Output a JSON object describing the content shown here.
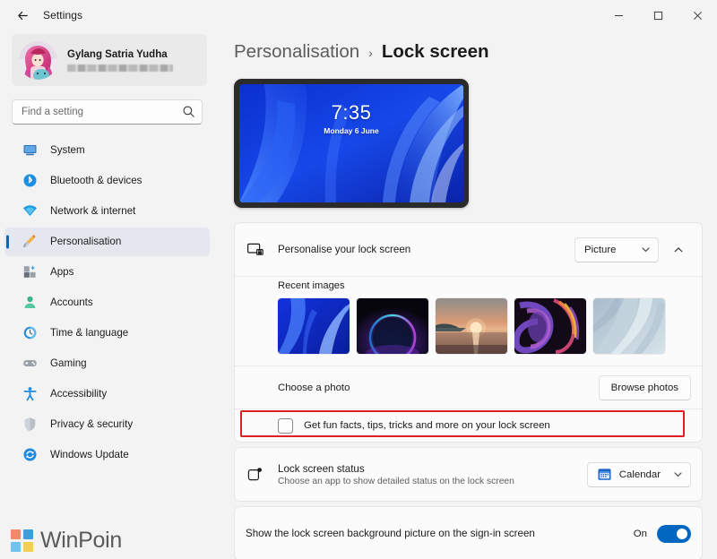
{
  "window": {
    "title": "Settings",
    "back_icon": "back-arrow-icon",
    "controls": {
      "minimize": "minimize-icon",
      "maximize": "maximize-icon",
      "close": "close-icon"
    }
  },
  "sidebar": {
    "account": {
      "name": "Gylang Satria Yudha",
      "email_redacted": true,
      "avatar_icon": "avatar"
    },
    "search": {
      "placeholder": "Find a setting",
      "value": "",
      "icon": "search-icon"
    },
    "items": [
      {
        "label": "System",
        "icon": "system-icon",
        "selected": false
      },
      {
        "label": "Bluetooth & devices",
        "icon": "bluetooth-icon",
        "selected": false
      },
      {
        "label": "Network & internet",
        "icon": "wifi-icon",
        "selected": false
      },
      {
        "label": "Personalisation",
        "icon": "paintbrush-icon",
        "selected": true
      },
      {
        "label": "Apps",
        "icon": "apps-icon",
        "selected": false
      },
      {
        "label": "Accounts",
        "icon": "accounts-icon",
        "selected": false
      },
      {
        "label": "Time & language",
        "icon": "clock-icon",
        "selected": false
      },
      {
        "label": "Gaming",
        "icon": "gamepad-icon",
        "selected": false
      },
      {
        "label": "Accessibility",
        "icon": "accessibility-icon",
        "selected": false
      },
      {
        "label": "Privacy & security",
        "icon": "shield-icon",
        "selected": false
      },
      {
        "label": "Windows Update",
        "icon": "update-icon",
        "selected": false
      }
    ]
  },
  "main": {
    "breadcrumb": {
      "parent": "Personalisation",
      "separator": "›",
      "current": "Lock screen"
    },
    "preview": {
      "time": "7:35",
      "date": "Monday 6 June"
    },
    "personalise": {
      "title": "Personalise your lock screen",
      "icon": "lock-screen-icon",
      "dropdown_value": "Picture",
      "dropdown_chevron": "chevron-down-icon",
      "expander_icon": "chevron-up-icon",
      "recent_images_label": "Recent images",
      "thumbnails": [
        {
          "name": "blue-bloom-wallpaper"
        },
        {
          "name": "dark-glow-wallpaper"
        },
        {
          "name": "sunset-lake-wallpaper"
        },
        {
          "name": "purple-abstract-wallpaper"
        },
        {
          "name": "light-blue-abstract-wallpaper"
        }
      ],
      "choose_photo_label": "Choose a photo",
      "browse_button": "Browse photos",
      "fun_facts_label": "Get fun facts, tips, tricks and more on your lock screen",
      "fun_facts_checked": false
    },
    "lock_screen_status": {
      "title": "Lock screen status",
      "subtitle": "Choose an app to show detailed status on the lock screen",
      "icon": "lock-screen-status-icon",
      "dropdown_value": "Calendar",
      "dropdown_app_icon": "calendar-icon",
      "dropdown_chevron": "chevron-down-icon"
    },
    "signin_background": {
      "title": "Show the lock screen background picture on the sign-in screen",
      "toggle_state": "On",
      "toggle_on": true
    }
  },
  "annotation": {
    "color": "#e02020",
    "target": "fun-facts-checkbox-row"
  },
  "watermark": {
    "text": "WinPoin",
    "colors": [
      "#f08a6a",
      "#3f9de0",
      "#6fc3f0",
      "#f2cf52"
    ]
  },
  "colors": {
    "accent": "#0067c0",
    "window_bg": "#f3f3f3",
    "card_bg": "#fbfbfb",
    "text": "#1b1b1b"
  }
}
